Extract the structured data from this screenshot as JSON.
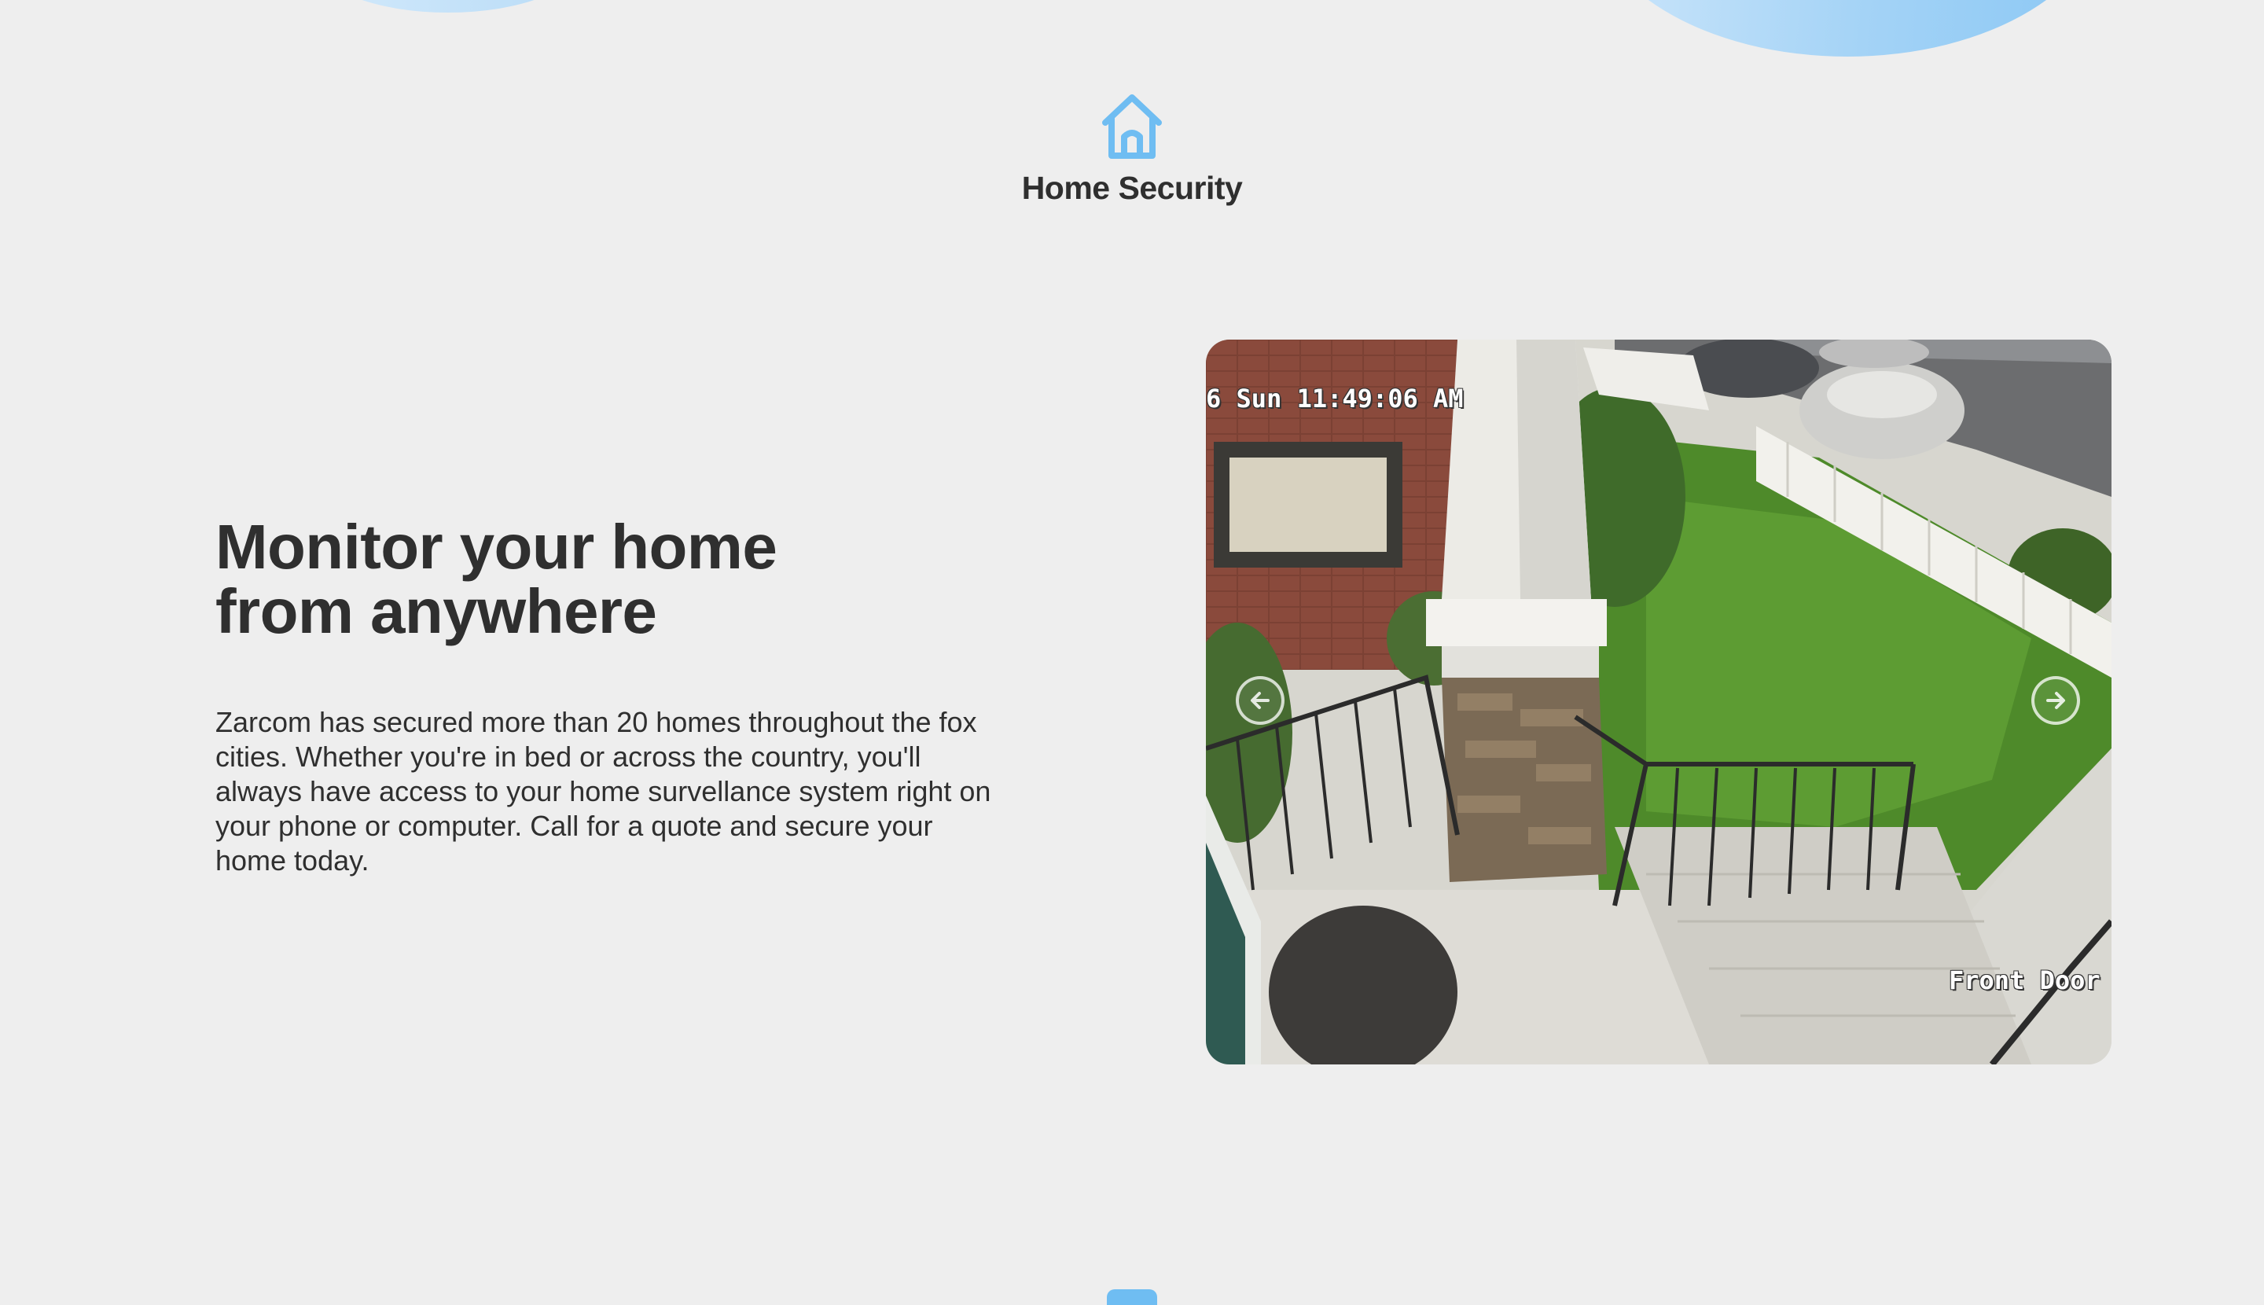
{
  "section": {
    "icon": "home-icon",
    "title": "Home Security"
  },
  "content": {
    "headline": "Monitor your home from anywhere",
    "body": "Zarcom has secured more than 20 homes throughout the fox cities. Whether you're in bed or across the country, you'll always have access to your home survellance system right on your phone or computer. Call for a quote and secure your home today."
  },
  "carousel": {
    "camera_timestamp": "6 Sun 11:49:06 AM",
    "camera_label": "Front Door",
    "prev_icon": "arrow-left-circle-icon",
    "next_icon": "arrow-right-circle-icon"
  },
  "colors": {
    "accent": "#6fbdf2",
    "background": "#eeeeee",
    "text": "#2f2f2f"
  }
}
